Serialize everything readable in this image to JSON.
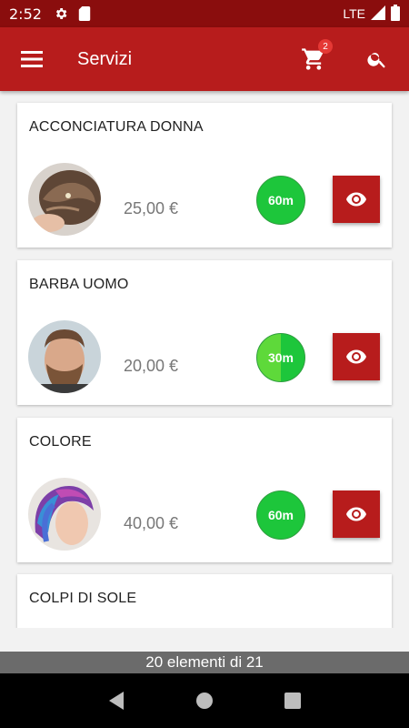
{
  "status_bar": {
    "time": "2:52",
    "network": "LTE"
  },
  "app_bar": {
    "title": "Servizi",
    "cart_count": "2"
  },
  "services": [
    {
      "name": "ACCONCIATURA DONNA",
      "price": "25,00 €",
      "duration": "60m",
      "duration_fill": 1.0
    },
    {
      "name": "BARBA UOMO",
      "price": "20,00 €",
      "duration": "30m",
      "duration_fill": 0.5
    },
    {
      "name": "COLORE",
      "price": "40,00 €",
      "duration": "60m",
      "duration_fill": 1.0
    },
    {
      "name": "COLPI DI SOLE"
    }
  ],
  "footer": {
    "count_text": "20 elementi di 21"
  },
  "colors": {
    "primary": "#b71c1c",
    "status_bar": "#8a0d0d",
    "duration_full": "#1dc63b",
    "duration_partial": "#5ed93a"
  }
}
